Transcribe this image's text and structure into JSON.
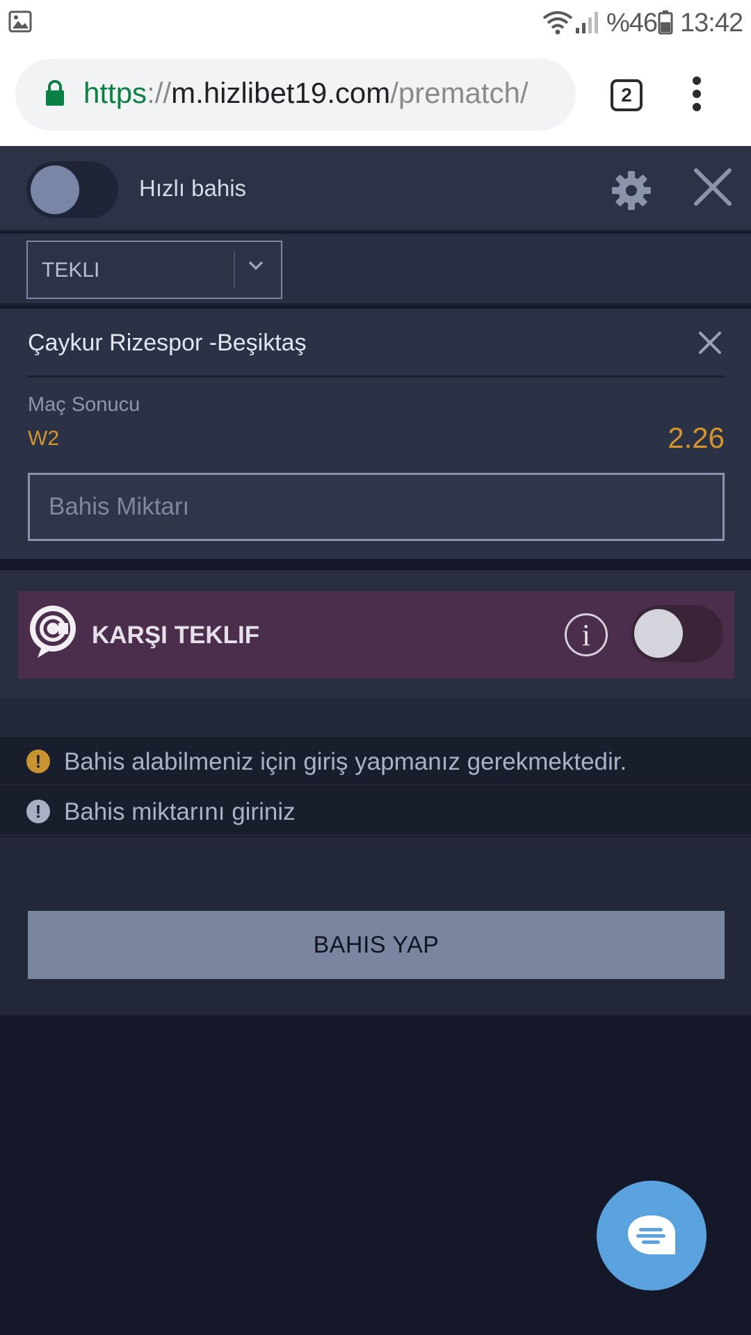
{
  "status_bar": {
    "battery_text": "%46",
    "time": "13:42"
  },
  "browser": {
    "url_scheme": "https",
    "url_sep": "://",
    "url_host": "m.hizlibet19.com",
    "url_path": "/prematch/",
    "tab_count": "2"
  },
  "betslip": {
    "quick_bet_label": "Hızlı bahis",
    "bet_type": "TEKLI",
    "event_title": "Çaykur Rizespor -Beşiktaş",
    "market": "Maç Sonucu",
    "selection": "W2",
    "odds": "2.26",
    "stake_placeholder": "Bahis Miktarı",
    "counter_offer_label": "KARŞI TEKLIF",
    "info_glyph": "i",
    "messages": [
      {
        "icon": "warning-icon",
        "text": "Bahis alabilmeniz için giriş yapmanız gerekmektedir.",
        "icon_color": "#c99331"
      },
      {
        "icon": "alert-icon",
        "text": "Bahis miktarını giriniz",
        "icon_color": "#a9b0c3"
      }
    ],
    "message_icon_glyph": "!",
    "place_bet_label": "BAHIS YAP"
  },
  "colors": {
    "accent_odds": "#d4952d",
    "counter_offer_bg": "#4a2e4b",
    "chat_fab": "#5aa3de",
    "place_bet_bg": "#7a869f"
  }
}
